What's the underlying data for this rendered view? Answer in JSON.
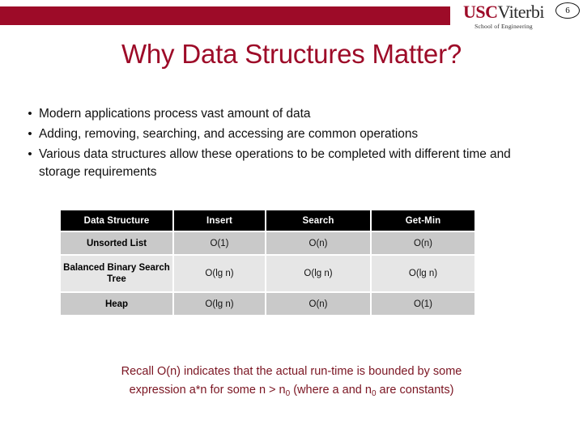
{
  "header": {
    "bar_color": "#9D0B28",
    "logo": {
      "usc": "USC",
      "viterbi": "Viterbi",
      "subtitle": "School of Engineering"
    },
    "page_number": "6"
  },
  "title": "Why Data Structures Matter?",
  "bullets": {
    "marker": "•",
    "items": [
      "Modern applications process vast amount of data",
      "Adding, removing, searching, and accessing are common operations",
      "Various data structures allow these operations to be completed with different time and storage requirements"
    ]
  },
  "table": {
    "headers": [
      "Data Structure",
      "Insert",
      "Search",
      "Get-Min"
    ],
    "rows": [
      {
        "name": "Unsorted List",
        "insert": "O(1)",
        "search": "O(n)",
        "getmin": "O(n)"
      },
      {
        "name": "Balanced Binary Search Tree",
        "insert": "O(lg n)",
        "search": "O(lg n)",
        "getmin": "O(lg n)"
      },
      {
        "name": "Heap",
        "insert": "O(lg n)",
        "search": "O(n)",
        "getmin": "O(1)"
      }
    ],
    "header_bg": "#000000",
    "header_fg": "#FFFFFF",
    "row_shade_bg": "#C9C9C9",
    "row_light_bg": "#E6E6E6"
  },
  "footnote": {
    "color": "#7B1522",
    "line1": "Recall O(n) indicates that the actual run-time is bounded by some",
    "line2_a": "expression a*n for some n > n",
    "line2_sub1": "0",
    "line2_b": " (where a and n",
    "line2_sub2": "0",
    "line2_c": " are constants)"
  }
}
